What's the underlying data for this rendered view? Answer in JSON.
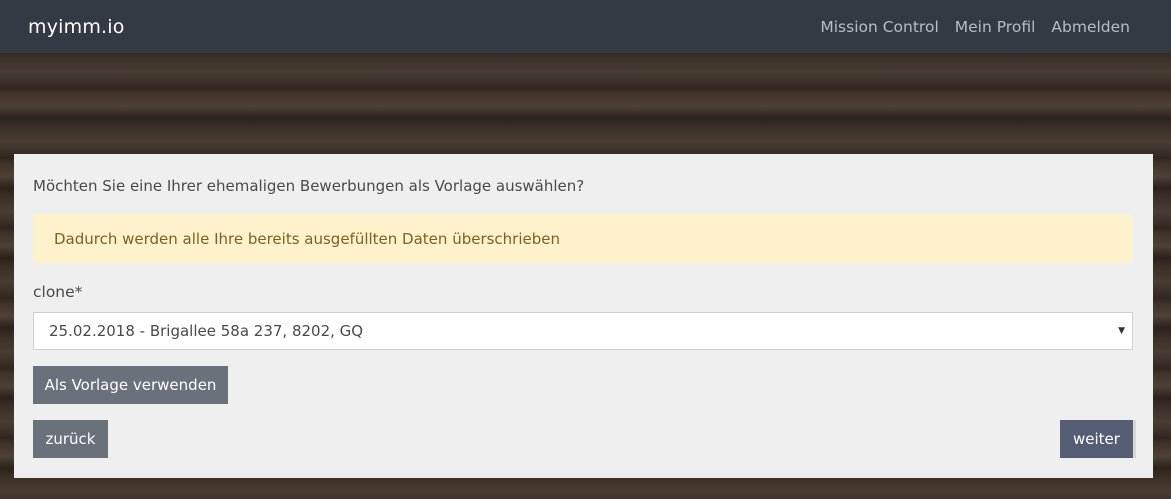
{
  "navbar": {
    "brand": "myimm.io",
    "links": [
      "Mission Control",
      "Mein Profil",
      "Abmelden"
    ]
  },
  "panel": {
    "question": "Möchten Sie eine Ihrer ehemaligen Bewerbungen als Vorlage auswählen?",
    "alert": "Dadurch werden alle Ihre bereits ausgefüllten Daten überschrieben",
    "field_label": "clone*",
    "select_value": "25.02.2018 - Brigallee 58a 237, 8202, GQ",
    "template_button": "Als Vorlage verwenden",
    "back_button": "zurück",
    "next_button": "weiter"
  },
  "colors": {
    "navbar": "#343a44",
    "alert_bg": "#fdf2cc",
    "alert_text": "#7b6223",
    "button_gray": "#6b717b",
    "button_primary": "#555d75"
  }
}
